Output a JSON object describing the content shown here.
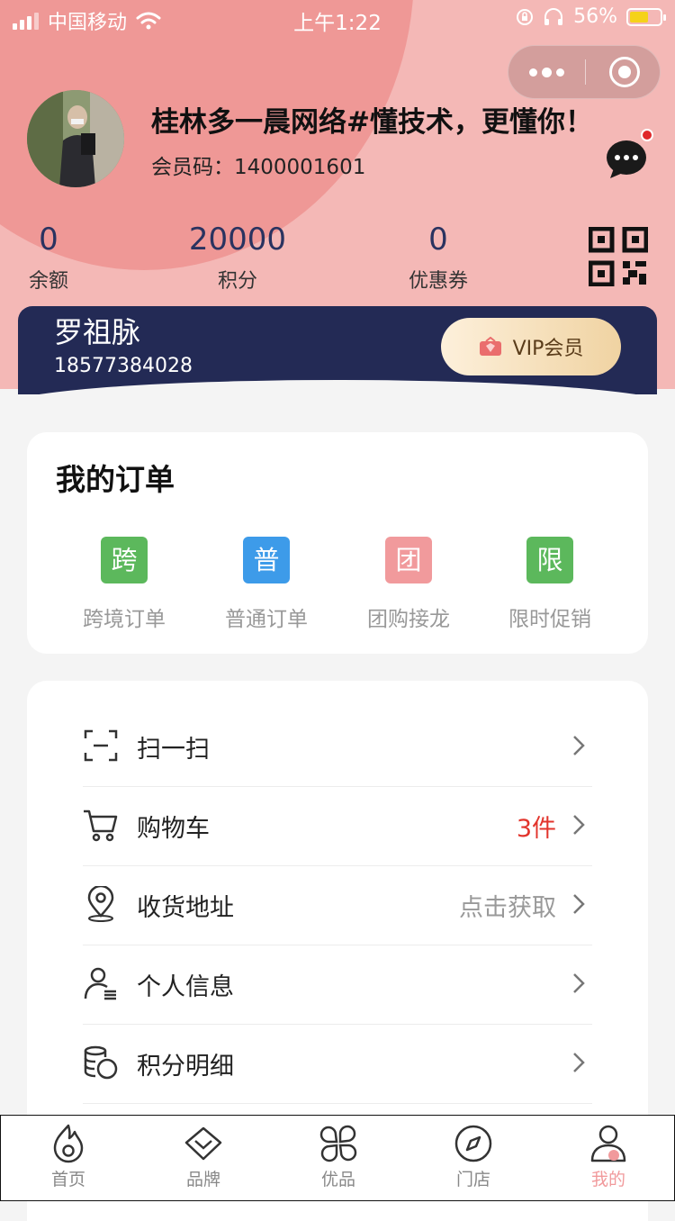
{
  "status_bar": {
    "carrier": "中国移动",
    "time": "上午1:22",
    "battery": "56%"
  },
  "profile": {
    "shop_name": "桂林多一晨网络#懂技术，更懂你！",
    "member_code": "会员码：1400001601"
  },
  "stats": [
    {
      "value": "0",
      "label": "余额"
    },
    {
      "value": "20000",
      "label": "积分"
    },
    {
      "value": "0",
      "label": "优惠券"
    }
  ],
  "vip": {
    "name": "罗祖脉",
    "phone": "18577384028",
    "button_label": "VIP会员"
  },
  "orders": {
    "title": "我的订单",
    "items": [
      {
        "badge": "跨",
        "label": "跨境订单",
        "color": "#5cb85c"
      },
      {
        "badge": "普",
        "label": "普通订单",
        "color": "#3d9be9"
      },
      {
        "badge": "团",
        "label": "团购接龙",
        "color": "#f19a9c"
      },
      {
        "badge": "限",
        "label": "限时促销",
        "color": "#5cb85c"
      }
    ]
  },
  "menu": [
    {
      "icon": "scan-icon",
      "label": "扫一扫",
      "value": ""
    },
    {
      "icon": "cart-icon",
      "label": "购物车",
      "value": "3件"
    },
    {
      "icon": "location-icon",
      "label": "收货地址",
      "value": "点击获取"
    },
    {
      "icon": "person-icon",
      "label": "个人信息",
      "value": ""
    },
    {
      "icon": "coins-icon",
      "label": "积分明细",
      "value": ""
    }
  ],
  "tabs": [
    {
      "icon": "flame-icon",
      "label": "首页"
    },
    {
      "icon": "diamond-icon",
      "label": "品牌"
    },
    {
      "icon": "grid-icon",
      "label": "优品"
    },
    {
      "icon": "compass-icon",
      "label": "门店"
    },
    {
      "icon": "user-icon",
      "label": "我的"
    }
  ],
  "colors": {
    "header_bg": "#f4b8b6",
    "header_circle": "#ef9896",
    "vip_card": "#232a55",
    "accent_red": "#e2342c",
    "active_tab": "#f19a9c"
  }
}
